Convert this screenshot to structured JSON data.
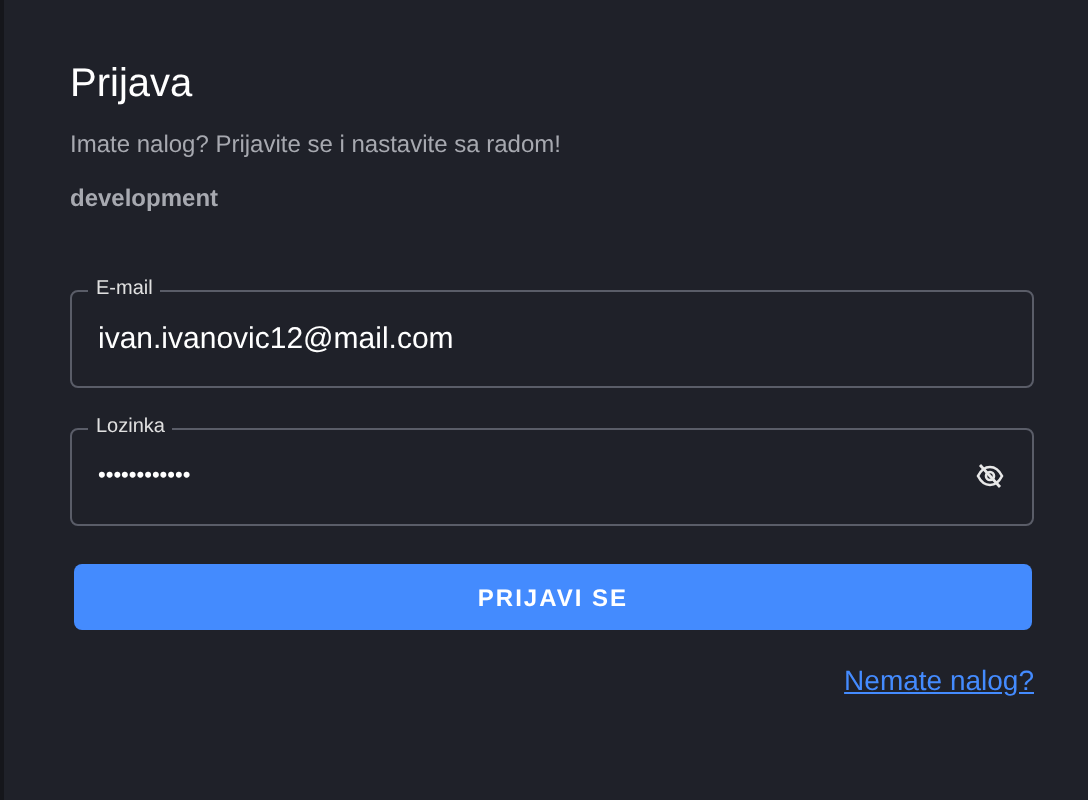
{
  "title": "Prijava",
  "subtitle": "Imate nalog? Prijavite se i nastavite sa radom!",
  "environment": "development",
  "fields": [
    {
      "label": "E-mail",
      "value": "ivan.ivanovic12@mail.com",
      "kind": "text"
    },
    {
      "label": "Lozinka",
      "value": "••••••••••••",
      "kind": "password"
    }
  ],
  "submit_button": "PRIJAVI SE",
  "register_link": "Nemate nalog?"
}
